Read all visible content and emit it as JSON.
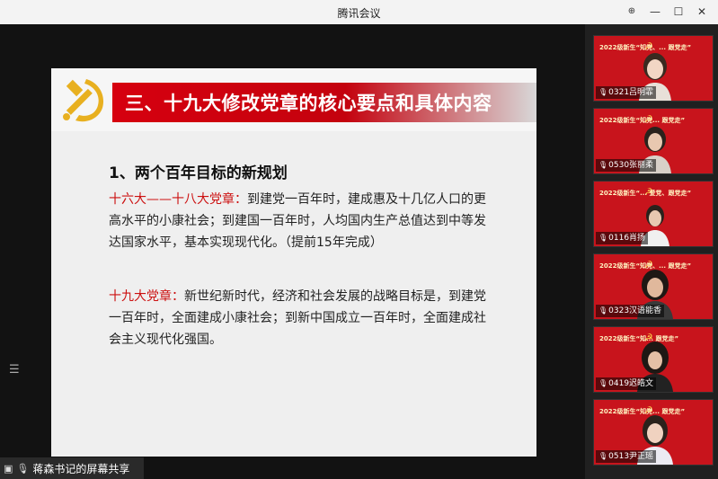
{
  "window": {
    "title": "腾讯会议",
    "buttons": [
      "⊕",
      "—",
      "☐",
      "✕"
    ]
  },
  "slide": {
    "header_title": "三、十九大修改党章的核心要点和具体内容",
    "subtitle": "1、两个百年目标的新规划",
    "para1": {
      "highlight": "十六大——十八大党章：",
      "text": "到建党一百年时，建成惠及十几亿人口的更高水平的小康社会；到建国一百年时，人均国内生产总值达到中等发达国家水平，基本实现现代化。（提前15年完成）"
    },
    "para2": {
      "highlight": "十九大党章：",
      "text": "新世纪新时代，经济和社会发展的战略目标是，到建党一百年时，全面建成小康社会；到新中国成立一百年时，全面建成社会主义现代化强国。"
    }
  },
  "share_status": "蒋森书记的屏幕共享",
  "participants": [
    {
      "name": "0321吕明霏",
      "banner": "2022级新生“知党、... 跟党走”",
      "sub": "入党教育"
    },
    {
      "name": "0530张丽柔",
      "banner": "2022级新生“知党... 跟党走”",
      "sub": "入党教育"
    },
    {
      "name": "0116肖扬",
      "banner": "2022级新生“... 爱党、跟党走”",
      "sub": "入党教育"
    },
    {
      "name": "0323汉语能香",
      "banner": "2022级新生“知党、... 跟党走”",
      "sub": "入党教育"
    },
    {
      "name": "0419迟皓文",
      "banner": "2022级新生“知... 跟党走”",
      "sub": "入党教育"
    },
    {
      "name": "0513尹正瑶",
      "banner": "2022级新生“知党... 跟党走”",
      "sub": ""
    }
  ],
  "colors": {
    "accent_red": "#d6000f",
    "highlight_red": "#cc1010",
    "emblem_gold": "#e8b020"
  },
  "icons": {
    "emblem": "hammer-sickle-icon",
    "mic": "mic-icon",
    "screen": "screen-share-icon",
    "menu": "menu-icon"
  }
}
